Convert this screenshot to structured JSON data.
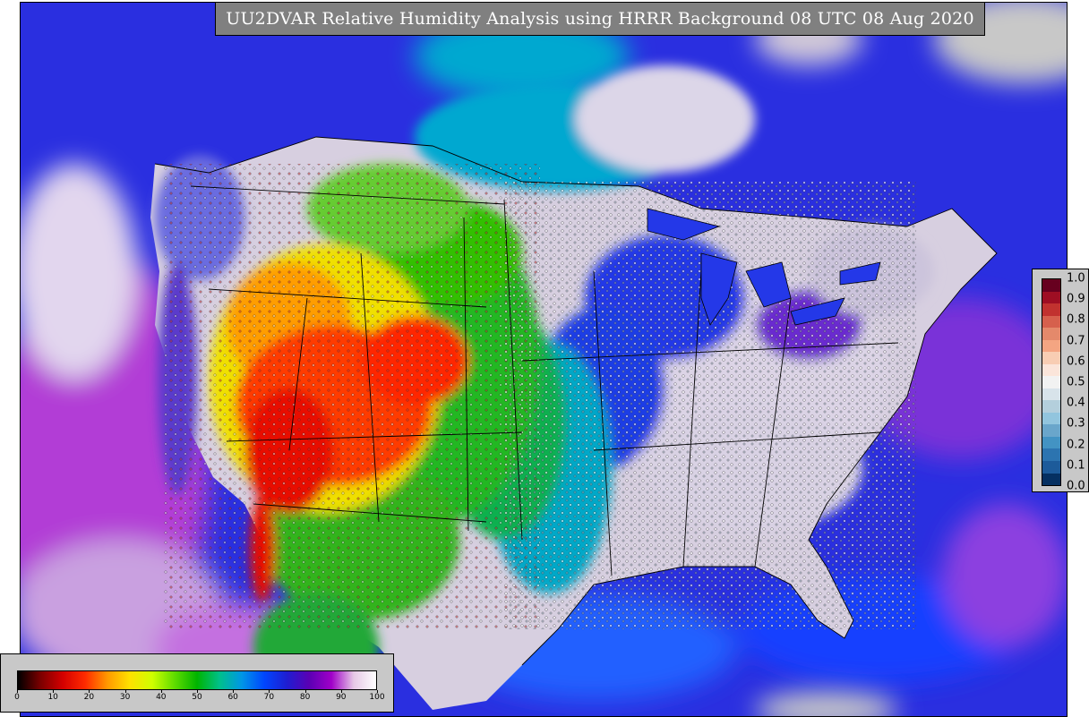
{
  "title": "UU2DVAR Relative Humidity Analysis using HRRR Background 08 UTC 08 Aug 2020",
  "horizontal_colorbar": {
    "ticks": [
      "0",
      "10",
      "20",
      "30",
      "40",
      "50",
      "60",
      "70",
      "80",
      "90",
      "100"
    ],
    "colors": [
      "#000000",
      "#7a0000",
      "#d40000",
      "#ff2a00",
      "#ff9900",
      "#ffe100",
      "#cfff00",
      "#5fdc00",
      "#00b400",
      "#00c08a",
      "#0096e6",
      "#0046ff",
      "#1e1ed2",
      "#5a00b4",
      "#a000c8",
      "#e6c8e6",
      "#ffffff"
    ]
  },
  "vertical_colorbar": {
    "ticks": [
      "1.0",
      "0.9",
      "0.8",
      "0.7",
      "0.6",
      "0.5",
      "0.4",
      "0.3",
      "0.2",
      "0.1",
      "0.0"
    ],
    "colors": [
      "#67001f",
      "#9e0e23",
      "#c1322f",
      "#d6604d",
      "#e4896b",
      "#f4a582",
      "#f8cdb3",
      "#fbe5da",
      "#f2f2f2",
      "#d8e3ea",
      "#b4cfdc",
      "#92c5de",
      "#6aa6cb",
      "#4393c3",
      "#2c74b0",
      "#1d5b9a",
      "#053061"
    ]
  }
}
